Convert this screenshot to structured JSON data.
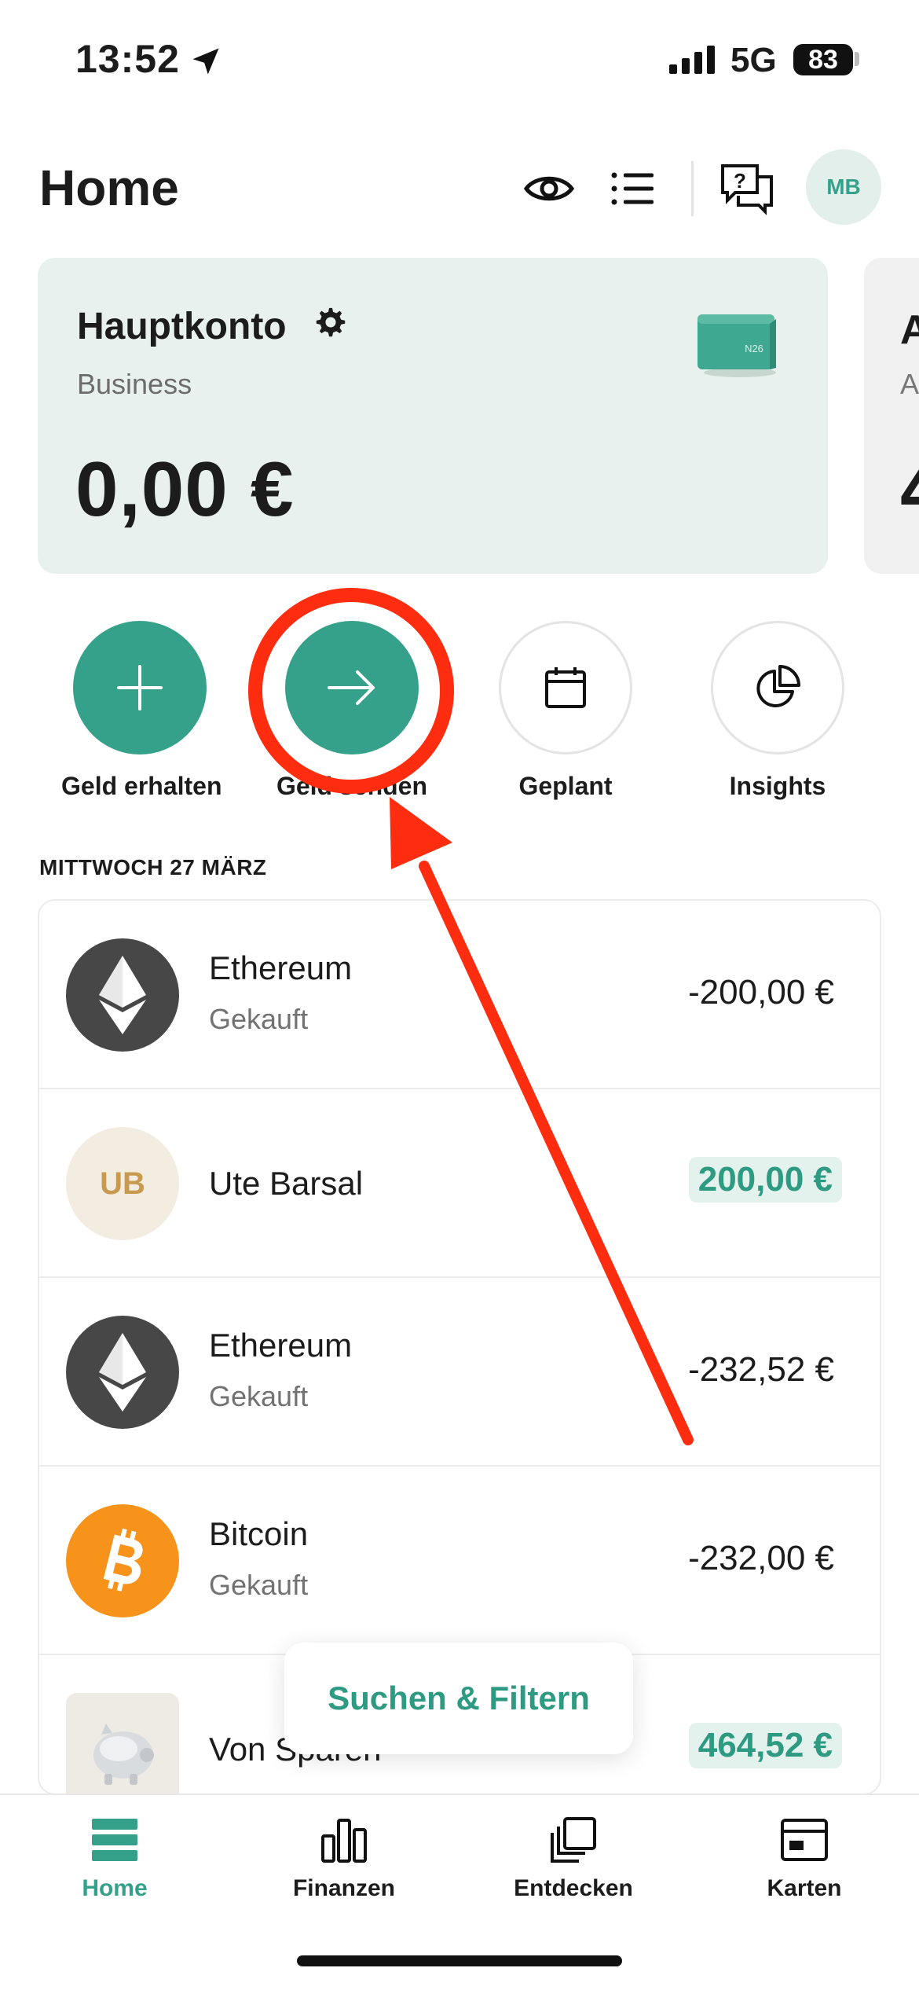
{
  "status_bar": {
    "time": "13:52",
    "network": "5G",
    "battery": "83"
  },
  "header": {
    "title": "Home",
    "avatar_initials": "MB"
  },
  "account_card": {
    "name": "Hauptkonto",
    "type": "Business",
    "balance": "0,00 €",
    "wallet_mark": "N26"
  },
  "peek_card": {
    "title_initial": "A",
    "sub_initial": "A",
    "balance_initial": "4"
  },
  "quick_actions": [
    {
      "label": "Geld erhalten",
      "icon": "plus-icon"
    },
    {
      "label": "Geld senden",
      "icon": "arrow-right-icon"
    },
    {
      "label": "Geplant",
      "icon": "calendar-icon"
    },
    {
      "label": "Insights",
      "icon": "pie-chart-icon"
    }
  ],
  "date_heading": "MITTWOCH 27 MÄRZ",
  "transactions": [
    {
      "title": "Ethereum",
      "subtitle": "Gekauft",
      "amount": "-200,00 €",
      "icon": "ethereum-icon"
    },
    {
      "title": "Ute Barsal",
      "subtitle": "",
      "amount": "200,00 €",
      "avatar_initials": "UB",
      "positive": true
    },
    {
      "title": "Ethereum",
      "subtitle": "Gekauft",
      "amount": "-232,52 €",
      "icon": "ethereum-icon"
    },
    {
      "title": "Bitcoin",
      "subtitle": "Gekauft",
      "amount": "-232,00 €",
      "icon": "bitcoin-icon"
    },
    {
      "title": "Von Sparen",
      "subtitle": "",
      "amount": "464,52 €",
      "icon": "piggy-bank-icon",
      "positive": true
    }
  ],
  "search_pill": "Suchen & Filtern",
  "bottom_nav": [
    {
      "label": "Home",
      "icon": "home-icon",
      "active": true
    },
    {
      "label": "Finanzen",
      "icon": "bar-chart-icon"
    },
    {
      "label": "Entdecken",
      "icon": "cards-stack-icon"
    },
    {
      "label": "Karten",
      "icon": "card-icon"
    }
  ],
  "colors": {
    "accent": "#36a18b",
    "card_bg": "#e8f1ed",
    "annotation": "#ff2d0f",
    "bitcoin": "#f7931a",
    "ethereum_bg": "#474747"
  }
}
